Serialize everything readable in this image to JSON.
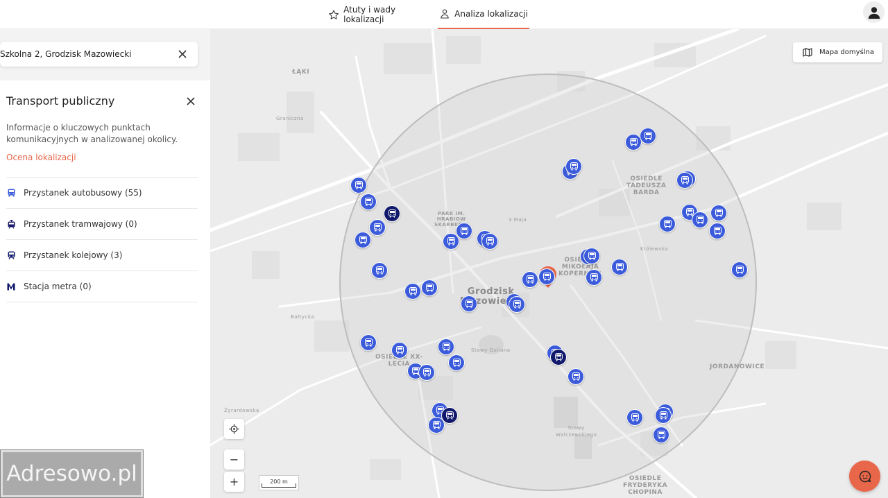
{
  "topbar": {
    "tab_pros_cons": "Atuty i wady lokalizacji",
    "tab_analysis": "Analiza lokalizacji"
  },
  "address": {
    "value": "Szkolna 2, Grodzisk Mazowiecki"
  },
  "panel": {
    "title": "Transport publiczny",
    "description": "Informacje o kluczowych punktach komunikacyjnych w analizowanej okolicy.",
    "link": "Ocena lokalizacji",
    "categories": [
      {
        "label": "Przystanek autobusowy (55)",
        "icon": "bus-icon"
      },
      {
        "label": "Przystanek tramwajowy (0)",
        "icon": "tram-icon"
      },
      {
        "label": "Przystanek kolejowy (3)",
        "icon": "train-icon"
      },
      {
        "label": "Stacja metra (0)",
        "icon": "metro-icon"
      }
    ]
  },
  "logo": {
    "text": "Adresowo.pl"
  },
  "map": {
    "map_type_label": "Mapa domyślna",
    "scale_label": "200 m",
    "zoom_in": "+",
    "zoom_out": "−",
    "labels": {
      "laki": "ŁĄKI",
      "grodzisk": "Grodzisk\nMazowiecki",
      "park": "PARK IM.\nHRABIOW\nSKARBKÓW",
      "osiedle_tb": "OSIEDLE\nTADEUSZA\nBARDA",
      "osiedle_mk": "OSIEDLE\nMIKOŁAJA\nKOPERNIKA",
      "osiedle_lecia": "OSIEDLE XX-\nLECIA",
      "jordanowice": "JORDANOWICE",
      "osiedle_fc": "OSIEDLE\nFRYDERYKA\nCHOPINA",
      "stawy_goliana": "Stawy Goliana",
      "stawy_walczewskiego": "Stawy\nWalczewskiego",
      "graniczna": "Graniczna",
      "3maja": "3 Maja",
      "krolewska": "Królewska",
      "zyrardowska": "Żyrardowska",
      "baltycka": "Bałtycka"
    },
    "colors": {
      "bus": "#3b5bdb",
      "rail": "#10196b",
      "accent": "#e8674a"
    }
  }
}
